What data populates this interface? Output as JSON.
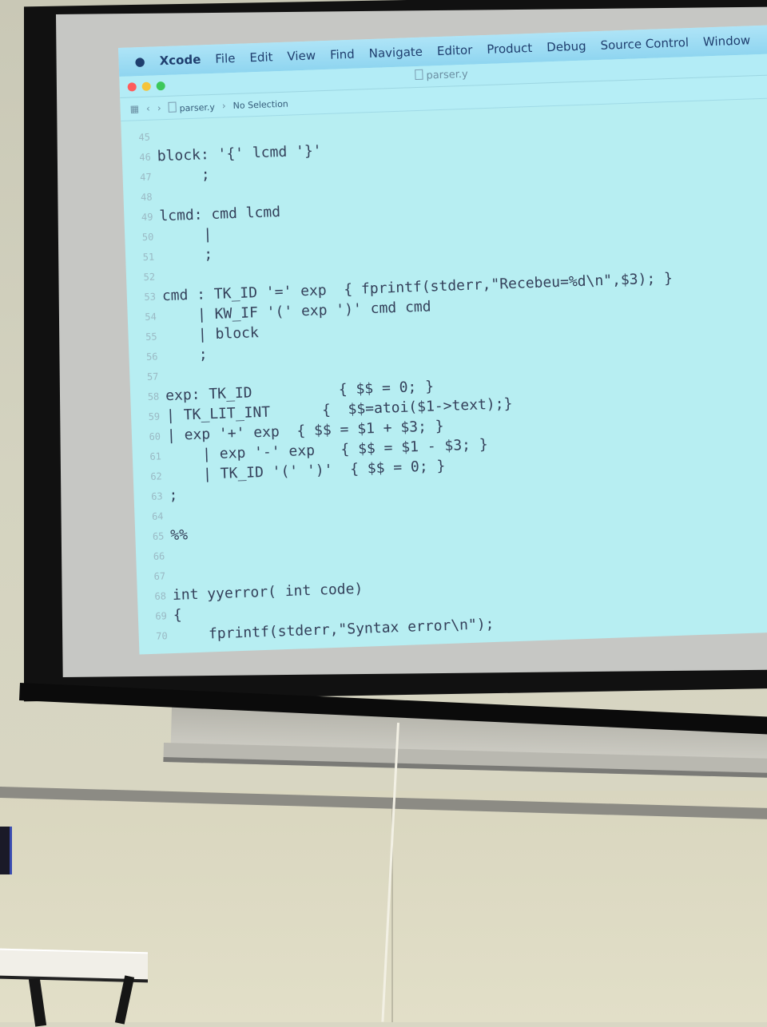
{
  "menubar": {
    "items": [
      "Xcode",
      "File",
      "Edit",
      "View",
      "Find",
      "Navigate",
      "Editor",
      "Product",
      "Debug",
      "Source Control",
      "Window"
    ]
  },
  "window": {
    "title": "parser.y"
  },
  "jumpbar": {
    "file": "parser.y",
    "selection": "No Selection"
  },
  "code_lines": [
    {
      "n": "45",
      "t": ""
    },
    {
      "n": "46",
      "t": "block: '{' lcmd '}'"
    },
    {
      "n": "47",
      "t": "     ;"
    },
    {
      "n": "48",
      "t": ""
    },
    {
      "n": "49",
      "t": "lcmd: cmd lcmd"
    },
    {
      "n": "50",
      "t": "     |"
    },
    {
      "n": "51",
      "t": "     ;"
    },
    {
      "n": "52",
      "t": ""
    },
    {
      "n": "53",
      "t": "cmd : TK_ID '=' exp  { fprintf(stderr,\"Recebeu=%d\\n\",$3); }"
    },
    {
      "n": "54",
      "t": "    | KW_IF '(' exp ')' cmd cmd"
    },
    {
      "n": "55",
      "t": "    | block"
    },
    {
      "n": "56",
      "t": "    ;"
    },
    {
      "n": "57",
      "t": ""
    },
    {
      "n": "58",
      "t": "exp: TK_ID          { $$ = 0; }"
    },
    {
      "n": "59",
      "t": "| TK_LIT_INT      {  $$=atoi($1->text);}"
    },
    {
      "n": "60",
      "t": "| exp '+' exp  { $$ = $1 + $3; }"
    },
    {
      "n": "61",
      "t": "    | exp '-' exp   { $$ = $1 - $3; }"
    },
    {
      "n": "62",
      "t": "    | TK_ID '(' ')'  { $$ = 0; }"
    },
    {
      "n": "63",
      "t": ";"
    },
    {
      "n": "64",
      "t": ""
    },
    {
      "n": "65",
      "t": "%%"
    },
    {
      "n": "66",
      "t": ""
    },
    {
      "n": "67",
      "t": ""
    },
    {
      "n": "68",
      "t": "int yyerror( int code)"
    },
    {
      "n": "69",
      "t": "{"
    },
    {
      "n": "70",
      "t": "    fprintf(stderr,\"Syntax error\\n\");"
    }
  ]
}
